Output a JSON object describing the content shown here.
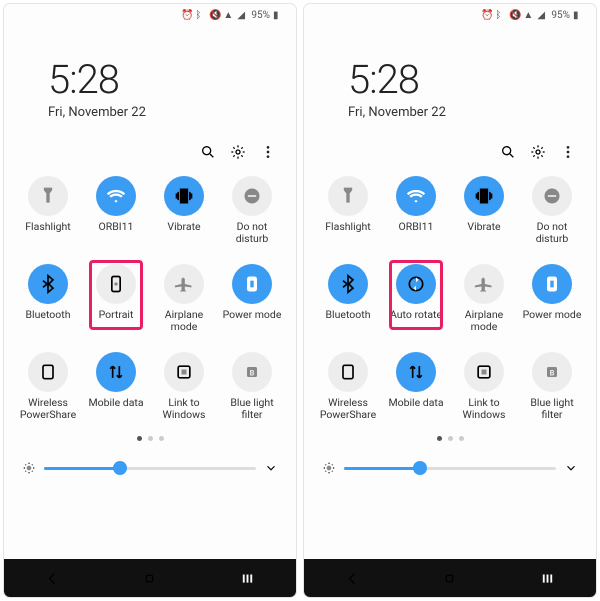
{
  "status": {
    "battery_pct": "95%"
  },
  "clock": {
    "time": "5:28",
    "date": "Fri, November 22"
  },
  "screens": [
    {
      "tiles": [
        {
          "label": "Flashlight",
          "active": false,
          "icon": "flashlight"
        },
        {
          "label": "ORBI11",
          "active": true,
          "icon": "wifi"
        },
        {
          "label": "Vibrate",
          "active": true,
          "icon": "vibrate"
        },
        {
          "label": "Do not disturb",
          "active": false,
          "icon": "dnd"
        },
        {
          "label": "Bluetooth",
          "active": true,
          "icon": "bluetooth"
        },
        {
          "label": "Portrait",
          "active": false,
          "icon": "portrait",
          "highlight": true
        },
        {
          "label": "Airplane mode",
          "active": false,
          "icon": "airplane"
        },
        {
          "label": "Power mode",
          "active": true,
          "icon": "power"
        },
        {
          "label": "Wireless PowerShare",
          "active": false,
          "icon": "powershare"
        },
        {
          "label": "Mobile data",
          "active": true,
          "icon": "mobiledata"
        },
        {
          "label": "Link to Windows",
          "active": false,
          "icon": "link"
        },
        {
          "label": "Blue light filter",
          "active": false,
          "icon": "bluelight"
        }
      ]
    },
    {
      "tiles": [
        {
          "label": "Flashlight",
          "active": false,
          "icon": "flashlight"
        },
        {
          "label": "ORBI11",
          "active": true,
          "icon": "wifi"
        },
        {
          "label": "Vibrate",
          "active": true,
          "icon": "vibrate"
        },
        {
          "label": "Do not disturb",
          "active": false,
          "icon": "dnd"
        },
        {
          "label": "Bluetooth",
          "active": true,
          "icon": "bluetooth"
        },
        {
          "label": "Auto rotate",
          "active": true,
          "icon": "autorotate",
          "highlight": true
        },
        {
          "label": "Airplane mode",
          "active": false,
          "icon": "airplane"
        },
        {
          "label": "Power mode",
          "active": true,
          "icon": "power"
        },
        {
          "label": "Wireless PowerShare",
          "active": false,
          "icon": "powershare"
        },
        {
          "label": "Mobile data",
          "active": true,
          "icon": "mobiledata"
        },
        {
          "label": "Link to Windows",
          "active": false,
          "icon": "link"
        },
        {
          "label": "Blue light filter",
          "active": false,
          "icon": "bluelight"
        }
      ]
    }
  ],
  "brightness_pct": 36,
  "page_dots": {
    "count": 3,
    "active": 0
  }
}
